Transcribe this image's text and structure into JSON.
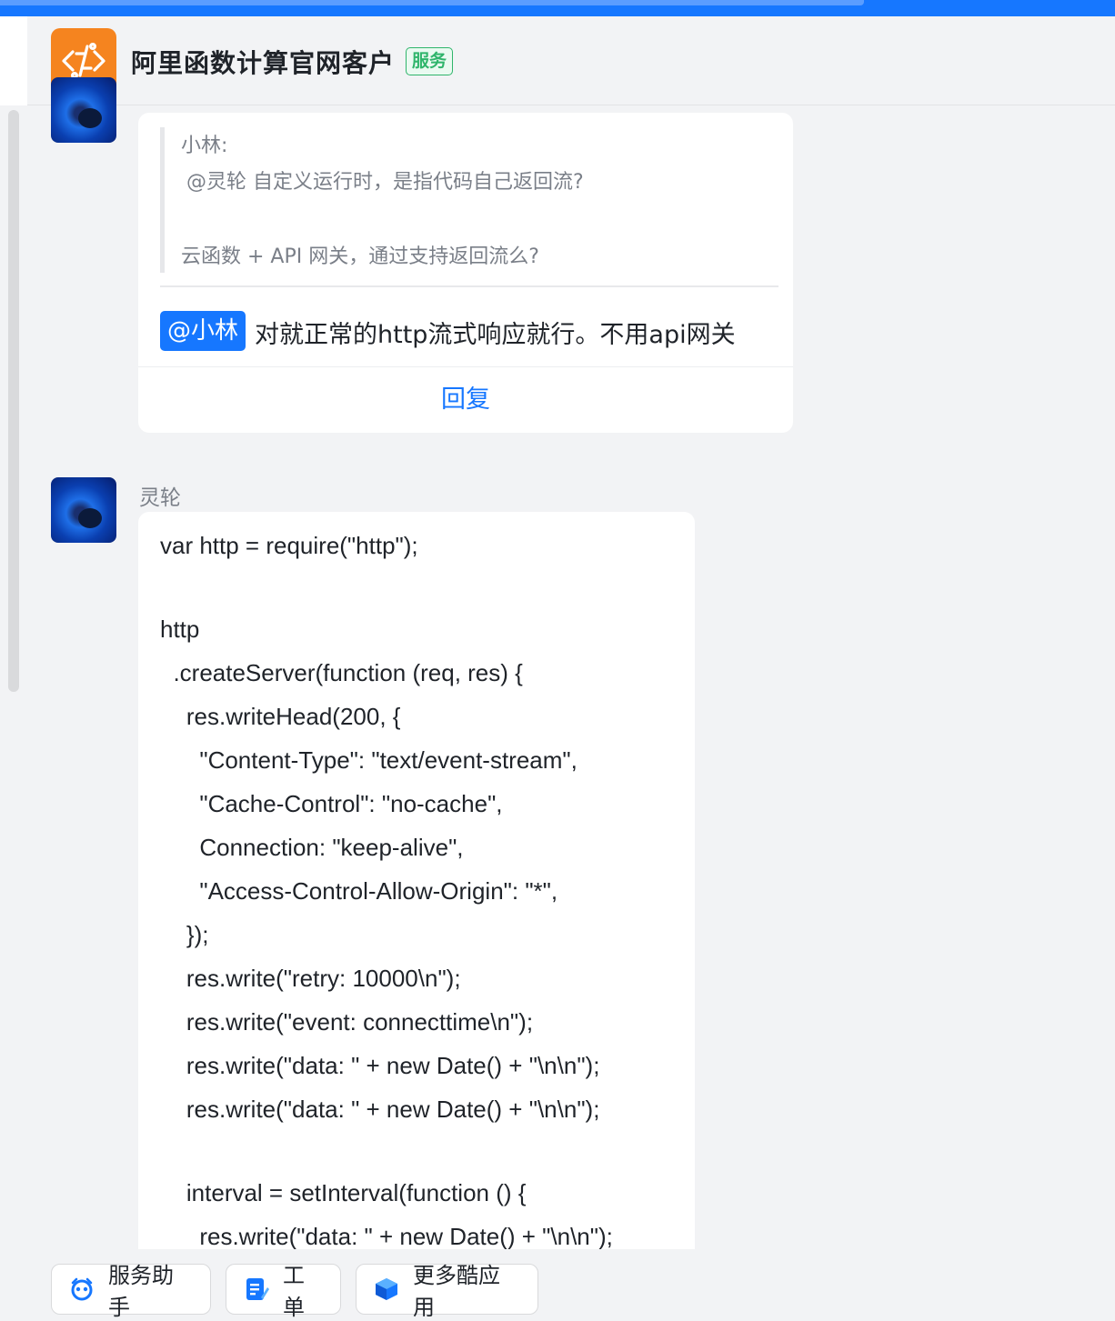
{
  "header": {
    "app_name": "阿里函数计算官网客户",
    "badge": "服务"
  },
  "message1": {
    "quote_author": "小林:",
    "quote_line1": "@灵轮  自定义运行时，是指代码自己返回流?",
    "quote_line2": "云函数 + API 网关，通过支持返回流么?",
    "mention": "@小林",
    "text": "对就正常的http流式响应就行。不用api网关",
    "reply_label": "回复"
  },
  "message2": {
    "sender": "灵轮",
    "code_lines": [
      "var http = require(\"http\");",
      "",
      "http",
      "  .createServer(function (req, res) {",
      "    res.writeHead(200, {",
      "      \"Content-Type\": \"text/event-stream\",",
      "      \"Cache-Control\": \"no-cache\",",
      "      Connection: \"keep-alive\",",
      "      \"Access-Control-Allow-Origin\": \"*\",",
      "    });",
      "    res.write(\"retry: 10000\\n\");",
      "    res.write(\"event: connecttime\\n\");",
      "    res.write(\"data: \" + new Date() + \"\\n\\n\");",
      "    res.write(\"data: \" + new Date() + \"\\n\\n\");",
      "",
      "    interval = setInterval(function () {",
      "      res.write(\"data: \" + new Date() + \"\\n\\n\");"
    ]
  },
  "bottom_bar": {
    "items": [
      {
        "label": "服务助手",
        "icon": "assistant-icon"
      },
      {
        "label": "工单",
        "icon": "ticket-icon"
      },
      {
        "label": "更多酷应用",
        "icon": "apps-cube-icon"
      }
    ]
  },
  "colors": {
    "accent": "#1677ff",
    "logo_bg": "#f5841f",
    "badge_green": "#2fb56b"
  }
}
